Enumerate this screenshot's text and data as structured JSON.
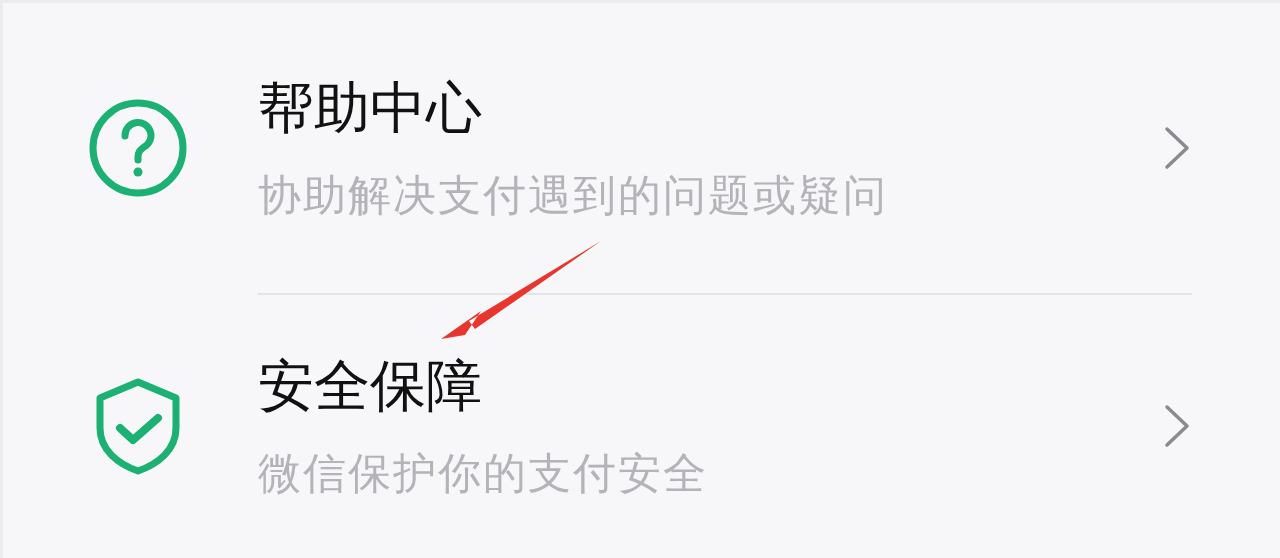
{
  "items": [
    {
      "kind": "help",
      "title": "帮助中心",
      "subtitle": "协助解决支付遇到的问题或疑问"
    },
    {
      "kind": "shield",
      "title": "安全保障",
      "subtitle": "微信保护你的支付安全"
    }
  ],
  "annotations": [
    {
      "kind": "arrow",
      "color": "#e8362f"
    }
  ]
}
